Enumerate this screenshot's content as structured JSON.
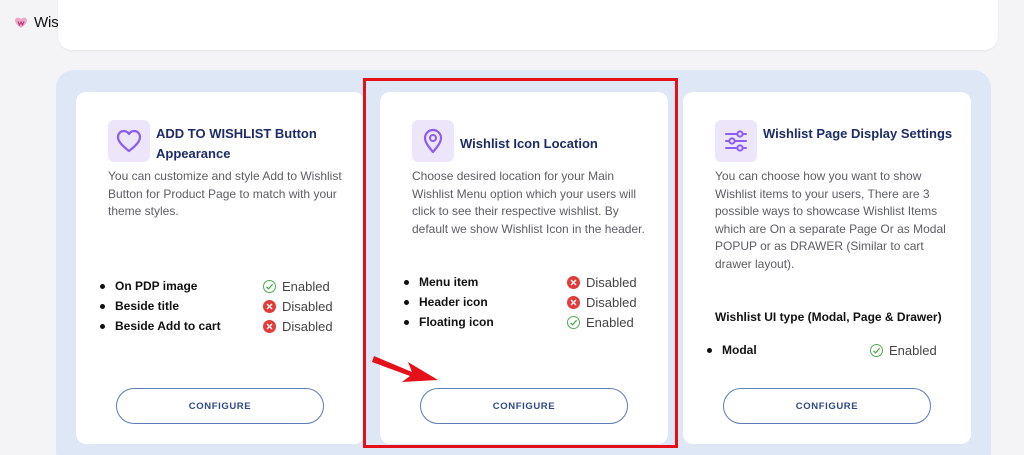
{
  "app": {
    "name": "Wishlist Guru",
    "logo_icon": "wishlist-guru-logo-icon"
  },
  "colors": {
    "accent": "#1d2c66",
    "icon_bg": "#ede6fb",
    "icon_stroke": "#8b5cf6",
    "enabled": "#4cae50",
    "disabled": "#e33a3a",
    "highlight": "#e5101a",
    "panel": "#dde7f6"
  },
  "cards": [
    {
      "icon": "heart-icon",
      "title": "ADD TO WISHLIST Button Appearance",
      "description": "You can customize and style Add to Wishlist Button for Product Page to match with your theme styles.",
      "options": [
        {
          "label": "On PDP image",
          "status": "Enabled"
        },
        {
          "label": "Beside title",
          "status": "Disabled"
        },
        {
          "label": "Beside Add to cart",
          "status": "Disabled"
        }
      ],
      "button": "CONFIGURE"
    },
    {
      "icon": "location-pin-icon",
      "title": "Wishlist Icon Location",
      "description": "Choose desired location for your Main Wishlist Menu option which your users will click to see their respective wishlist. By default we show Wishlist Icon in the header.",
      "options": [
        {
          "label": "Menu item",
          "status": "Disabled"
        },
        {
          "label": "Header icon",
          "status": "Disabled"
        },
        {
          "label": "Floating icon",
          "status": "Enabled"
        }
      ],
      "button": "CONFIGURE"
    },
    {
      "icon": "sliders-icon",
      "title": "Wishlist Page Display Settings",
      "description": "You can choose how you want to show Wishlist items to your users, There are 3 possible ways to showcase Wishlist Items which are On a separate Page Or as Modal POPUP or as DRAWER (Similar to cart drawer layout).",
      "ui_type_label": "Wishlist UI type (Modal, Page & Drawer)",
      "options": [
        {
          "label": "Modal",
          "status": "Enabled"
        }
      ],
      "button": "CONFIGURE"
    }
  ]
}
